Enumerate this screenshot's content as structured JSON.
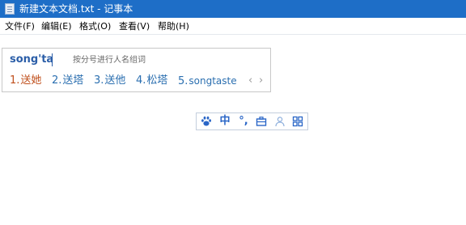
{
  "window": {
    "title": "新建文本文档.txt - 记事本"
  },
  "menubar": {
    "items": [
      "文件(F)",
      "编辑(E)",
      "格式(O)",
      "查看(V)",
      "帮助(H)"
    ]
  },
  "ime": {
    "composition": "song'ta",
    "hint": "按分号进行人名组词",
    "candidates": [
      {
        "num": "1.",
        "text": "送她"
      },
      {
        "num": "2.",
        "text": "送塔"
      },
      {
        "num": "3.",
        "text": "送他"
      },
      {
        "num": "4.",
        "text": "松塔"
      },
      {
        "num": "5.",
        "text": "songtaste"
      }
    ],
    "prev_symbol": "‹",
    "next_symbol": "›",
    "colors": {
      "selected": "#c0501d",
      "candidate": "#2b6fb0",
      "toolbar_icons": "#2a66c7"
    }
  },
  "ime_toolbar": {
    "lang_label": "中",
    "punct_label": "°,",
    "icons": [
      "paw-icon",
      "lang-toggle",
      "punctuation-toggle",
      "toolbox-icon",
      "user-icon",
      "grid-menu-icon"
    ]
  }
}
